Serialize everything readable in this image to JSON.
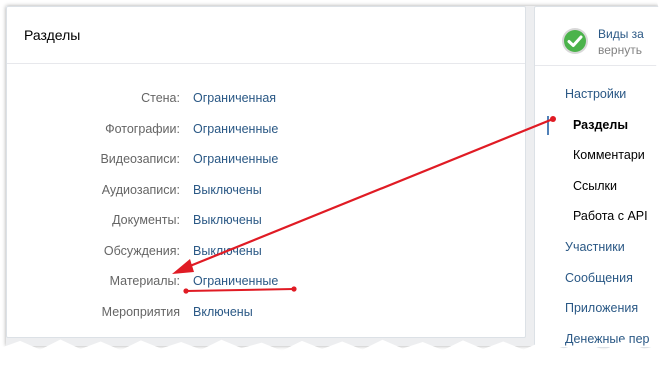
{
  "sections_panel": {
    "title": "Разделы",
    "rows": [
      {
        "label": "Стена:",
        "value": "Ограниченная"
      },
      {
        "label": "Фотографии:",
        "value": "Ограниченные"
      },
      {
        "label": "Видеозаписи:",
        "value": "Ограниченные"
      },
      {
        "label": "Аудиозаписи:",
        "value": "Выключены"
      },
      {
        "label": "Документы:",
        "value": "Выключены"
      },
      {
        "label": "Обсуждения:",
        "value": "Выключены"
      },
      {
        "label": "Материалы:",
        "value": "Ограниченные"
      },
      {
        "label": "Мероприятия",
        "value": "Включены"
      }
    ]
  },
  "side_panel": {
    "notice": {
      "title": "Виды за",
      "subtitle": "вернуть"
    },
    "menu": [
      {
        "label": "Настройки",
        "kind": "top"
      },
      {
        "label": "Разделы",
        "kind": "active"
      },
      {
        "label": "Комментари",
        "kind": "sub"
      },
      {
        "label": "Ссылки",
        "kind": "sub"
      },
      {
        "label": "Работа с API",
        "kind": "sub"
      },
      {
        "label": "Участники",
        "kind": "top"
      },
      {
        "label": "Сообщения",
        "kind": "top"
      },
      {
        "label": "Приложения",
        "kind": "top"
      },
      {
        "label": "Денежные пер",
        "kind": "top"
      }
    ]
  },
  "colors": {
    "link": "#2a5885",
    "label": "#656565",
    "annotation": "#e01b24",
    "success": "#4bb34b"
  },
  "icons": {
    "notice_icon": "check-circle-icon"
  }
}
